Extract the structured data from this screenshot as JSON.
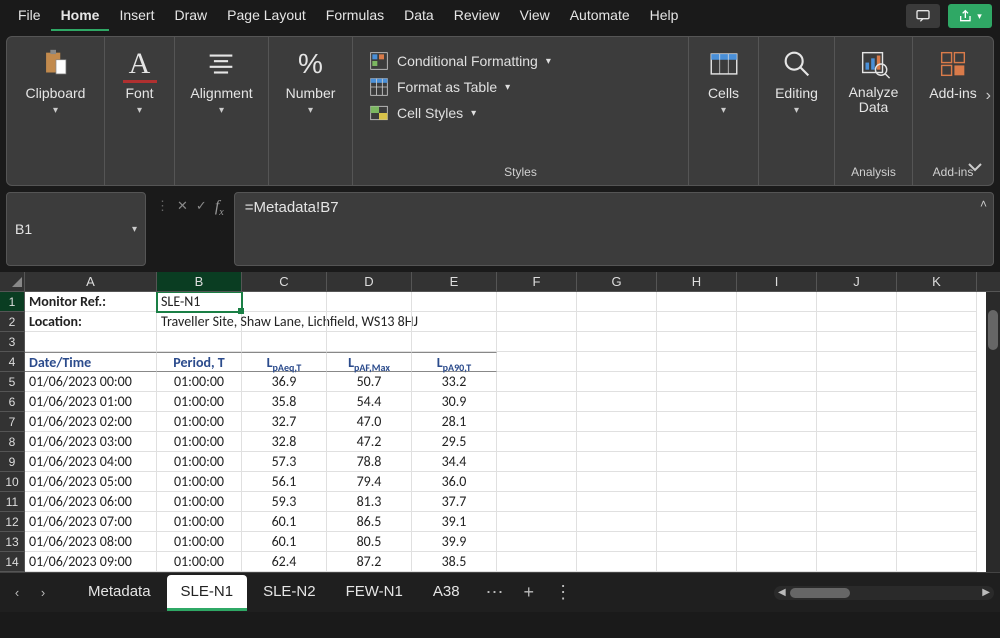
{
  "ribbon_tabs": [
    "File",
    "Home",
    "Insert",
    "Draw",
    "Page Layout",
    "Formulas",
    "Data",
    "Review",
    "View",
    "Automate",
    "Help"
  ],
  "active_ribbon_tab": "Home",
  "ribbon_groups": {
    "clipboard": "Clipboard",
    "font": "Font",
    "alignment": "Alignment",
    "number": "Number",
    "styles": "Styles",
    "cells": "Cells",
    "editing": "Editing",
    "analysis": "Analysis",
    "addins": "Add-ins"
  },
  "ribbon_buttons": {
    "analyze_data": "Analyze Data",
    "addins": "Add-ins",
    "cond_fmt": "Conditional Formatting",
    "fmt_table": "Format as Table",
    "cell_styles": "Cell Styles"
  },
  "namebox": "B1",
  "formula": "=Metadata!B7",
  "columns": [
    "A",
    "B",
    "C",
    "D",
    "E",
    "F",
    "G",
    "H",
    "I",
    "J",
    "K"
  ],
  "meta_rows": {
    "r1_label": "Monitor Ref.:",
    "r1_value": "SLE-N1",
    "r2_label": "Location:",
    "r2_value": "Traveller Site, Shaw Lane, Lichfield, WS13 8HJ"
  },
  "headers": {
    "A": "Date/Time",
    "B": "Period, T",
    "C_pre": "L",
    "C_sub": "pAeq,T",
    "D_pre": "L",
    "D_sub": "pAF,Max",
    "E_pre": "L",
    "E_sub": "pA90,T"
  },
  "rows": [
    {
      "n": 5,
      "dt": "01/06/2023 00:00",
      "p": "01:00:00",
      "c": "36.9",
      "d": "50.7",
      "e": "33.2"
    },
    {
      "n": 6,
      "dt": "01/06/2023 01:00",
      "p": "01:00:00",
      "c": "35.8",
      "d": "54.4",
      "e": "30.9"
    },
    {
      "n": 7,
      "dt": "01/06/2023 02:00",
      "p": "01:00:00",
      "c": "32.7",
      "d": "47.0",
      "e": "28.1"
    },
    {
      "n": 8,
      "dt": "01/06/2023 03:00",
      "p": "01:00:00",
      "c": "32.8",
      "d": "47.2",
      "e": "29.5"
    },
    {
      "n": 9,
      "dt": "01/06/2023 04:00",
      "p": "01:00:00",
      "c": "57.3",
      "d": "78.8",
      "e": "34.4"
    },
    {
      "n": 10,
      "dt": "01/06/2023 05:00",
      "p": "01:00:00",
      "c": "56.1",
      "d": "79.4",
      "e": "36.0"
    },
    {
      "n": 11,
      "dt": "01/06/2023 06:00",
      "p": "01:00:00",
      "c": "59.3",
      "d": "81.3",
      "e": "37.7"
    },
    {
      "n": 12,
      "dt": "01/06/2023 07:00",
      "p": "01:00:00",
      "c": "60.1",
      "d": "86.5",
      "e": "39.1"
    },
    {
      "n": 13,
      "dt": "01/06/2023 08:00",
      "p": "01:00:00",
      "c": "60.1",
      "d": "80.5",
      "e": "39.9"
    },
    {
      "n": 14,
      "dt": "01/06/2023 09:00",
      "p": "01:00:00",
      "c": "62.4",
      "d": "87.2",
      "e": "38.5"
    }
  ],
  "sheet_tabs": [
    "Metadata",
    "SLE-N1",
    "SLE-N2",
    "FEW-N1",
    "A38"
  ],
  "active_sheet": "SLE-N1"
}
